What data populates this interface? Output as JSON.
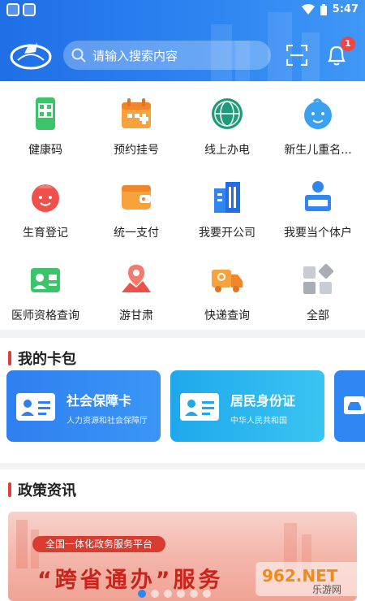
{
  "status_bar": {
    "time": "5:47"
  },
  "header": {
    "search_placeholder": "请输入搜索内容",
    "notification_count": "1"
  },
  "services": [
    {
      "label": "健康码",
      "icon": "health-code-phone-icon"
    },
    {
      "label": "预约挂号",
      "icon": "appointment-calendar-icon"
    },
    {
      "label": "线上办电",
      "icon": "state-grid-icon"
    },
    {
      "label": "新生儿重名...",
      "icon": "baby-face-icon"
    },
    {
      "label": "生育登记",
      "icon": "baby-registration-icon"
    },
    {
      "label": "统一支付",
      "icon": "wallet-icon"
    },
    {
      "label": "我要开公司",
      "icon": "office-building-icon"
    },
    {
      "label": "我要当个体户",
      "icon": "individual-business-icon"
    },
    {
      "label": "医师资格查询",
      "icon": "doctor-license-icon"
    },
    {
      "label": "游甘肃",
      "icon": "map-pin-icon"
    },
    {
      "label": "快递查询",
      "icon": "delivery-truck-icon"
    },
    {
      "label": "全部",
      "icon": "all-grid-icon"
    }
  ],
  "card_pack": {
    "title": "我的卡包",
    "cards": [
      {
        "title": "社会保障卡",
        "subtitle": "人力资源和社会保障厅",
        "icon": "id-card-icon"
      },
      {
        "title": "居民身份证",
        "subtitle": "中华人民共和国",
        "icon": "id-card-icon"
      },
      {
        "title": "",
        "subtitle": "",
        "icon": "car-icon"
      }
    ]
  },
  "policy": {
    "title": "政策资讯",
    "banner_tag": "全国一体化政务服务平台",
    "banner_headline": "“跨省通办”服务"
  },
  "watermark": {
    "text": "962.NET",
    "subtext": "乐游网"
  },
  "colors": {
    "header": "#2f86f2",
    "accent_red": "#e23b3b",
    "card_blue": "#2f86f2",
    "card_cyan": "#26b5ec"
  }
}
